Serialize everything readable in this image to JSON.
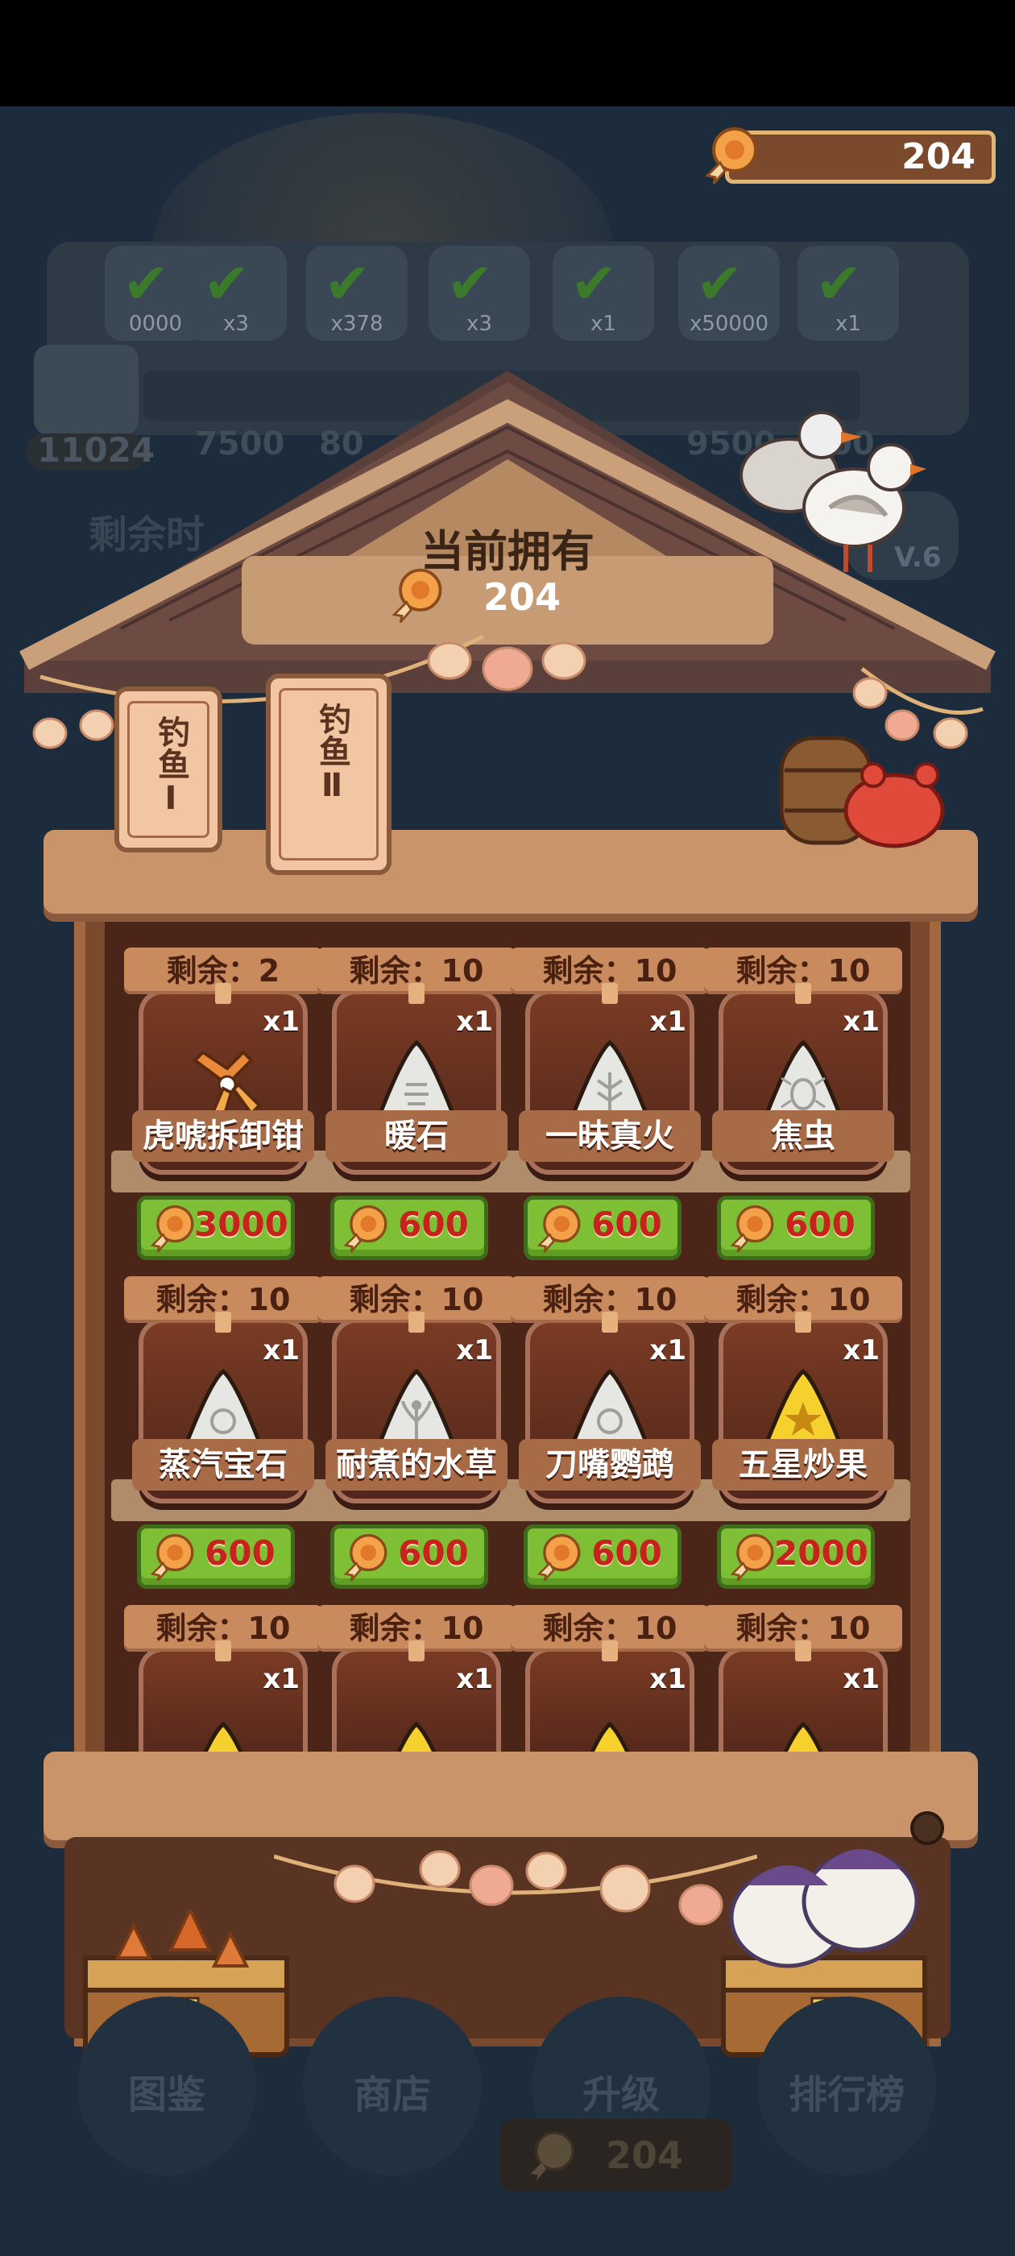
{
  "coins": {
    "value": "204"
  },
  "background": {
    "task_items": [
      {
        "qty": "0000"
      },
      {
        "qty": "x3"
      },
      {
        "qty": "x378"
      },
      {
        "qty": "x3"
      },
      {
        "qty": "x1"
      },
      {
        "qty": "x50000"
      },
      {
        "qty": "x1"
      }
    ],
    "progress_numbers": [
      "7500",
      "80",
      "9500",
      "00"
    ],
    "timer": "11024",
    "remain_label": "剩余时",
    "level": "V.6"
  },
  "shop": {
    "title": "当前拥有",
    "owned": "204",
    "tabs": [
      {
        "label": "钓鱼Ⅰ"
      },
      {
        "label": "钓鱼Ⅱ"
      }
    ],
    "remain_prefix": "剩余：",
    "rows": [
      [
        {
          "name": "虎唬拆卸钳",
          "remain": "剩余：2",
          "qty": "x1",
          "price": "3000",
          "icon": "pliers-icon"
        },
        {
          "name": "暖石",
          "remain": "剩余：10",
          "qty": "x1",
          "price": "600",
          "icon": "stone-icon"
        },
        {
          "name": "一昧真火",
          "remain": "剩余：10",
          "qty": "x1",
          "price": "600",
          "icon": "leaf-stone-icon"
        },
        {
          "name": "焦虫",
          "remain": "剩余：10",
          "qty": "x1",
          "price": "600",
          "icon": "bug-stone-icon"
        }
      ],
      [
        {
          "name": "蒸汽宝石",
          "remain": "剩余：10",
          "qty": "x1",
          "price": "600",
          "icon": "spiral-stone-icon"
        },
        {
          "name": "耐煮的水草",
          "remain": "剩余：10",
          "qty": "x1",
          "price": "600",
          "icon": "plant-stone-icon"
        },
        {
          "name": "刀嘴鹦鹉",
          "remain": "剩余：10",
          "qty": "x1",
          "price": "600",
          "icon": "snail-stone-icon"
        },
        {
          "name": "五星炒果",
          "remain": "剩余：10",
          "qty": "x1",
          "price": "2000",
          "icon": "star-stone-icon"
        }
      ],
      [
        {
          "name": "",
          "remain": "剩余：10",
          "qty": "x1",
          "price": "",
          "icon": "gold-stone-icon"
        },
        {
          "name": "",
          "remain": "剩余：10",
          "qty": "x1",
          "price": "",
          "icon": "gold-stone-icon"
        },
        {
          "name": "",
          "remain": "剩余：10",
          "qty": "x1",
          "price": "",
          "icon": "gold-stone-icon"
        },
        {
          "name": "",
          "remain": "剩余：10",
          "qty": "x1",
          "price": "",
          "icon": "gold-stone-icon"
        }
      ]
    ]
  },
  "footer": {
    "nav": [
      {
        "label": "图鉴"
      },
      {
        "label": "商店"
      },
      {
        "label": "升级"
      },
      {
        "label": "排行榜"
      }
    ],
    "coins": "204"
  },
  "colors": {
    "price_green": "#7fbf36",
    "price_red": "#c5231b",
    "wood": "#c9946a",
    "card_brown": "#7a3b24"
  }
}
